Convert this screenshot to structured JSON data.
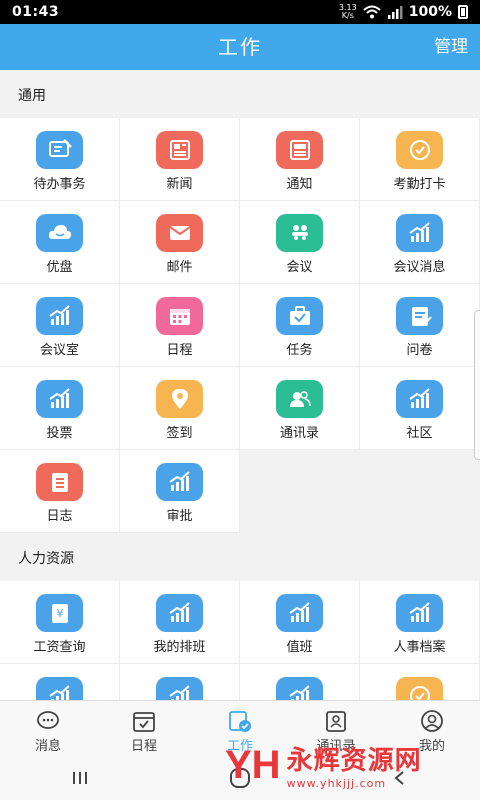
{
  "status_bar": {
    "time": "01:43",
    "net_speed_value": "3.13",
    "net_speed_unit": "K/s",
    "battery": "100%"
  },
  "header": {
    "title": "工作",
    "manage": "管理"
  },
  "sections": [
    {
      "title": "通用",
      "items": [
        {
          "label": "待办事务",
          "icon": "todo-icon",
          "color": "#4aa3e9"
        },
        {
          "label": "新闻",
          "icon": "newspaper-icon",
          "color": "#f06a5c"
        },
        {
          "label": "通知",
          "icon": "notice-icon",
          "color": "#f06a5c"
        },
        {
          "label": "考勤打卡",
          "icon": "attendance-icon",
          "color": "#f7b552"
        },
        {
          "label": "优盘",
          "icon": "cloud-icon",
          "color": "#4aa3e9"
        },
        {
          "label": "邮件",
          "icon": "mail-icon",
          "color": "#f06a5c"
        },
        {
          "label": "会议",
          "icon": "meeting-icon",
          "color": "#2bbd93"
        },
        {
          "label": "会议消息",
          "icon": "chart-icon",
          "color": "#4aa3e9"
        },
        {
          "label": "会议室",
          "icon": "chart-icon",
          "color": "#4aa3e9"
        },
        {
          "label": "日程",
          "icon": "calendar-icon",
          "color": "#f0699a"
        },
        {
          "label": "任务",
          "icon": "task-icon",
          "color": "#4aa3e9"
        },
        {
          "label": "问卷",
          "icon": "survey-icon",
          "color": "#4aa3e9"
        },
        {
          "label": "投票",
          "icon": "chart-icon",
          "color": "#4aa3e9"
        },
        {
          "label": "签到",
          "icon": "location-icon",
          "color": "#f7b552"
        },
        {
          "label": "通讯录",
          "icon": "contacts-icon",
          "color": "#2bbd93"
        },
        {
          "label": "社区",
          "icon": "chart-icon",
          "color": "#4aa3e9"
        },
        {
          "label": "日志",
          "icon": "log-icon",
          "color": "#f06a5c"
        },
        {
          "label": "审批",
          "icon": "chart-icon",
          "color": "#4aa3e9"
        }
      ]
    },
    {
      "title": "人力资源",
      "items": [
        {
          "label": "工资查询",
          "icon": "salary-icon",
          "color": "#4aa3e9"
        },
        {
          "label": "我的排班",
          "icon": "chart-icon",
          "color": "#4aa3e9"
        },
        {
          "label": "值班",
          "icon": "chart-icon",
          "color": "#4aa3e9"
        },
        {
          "label": "人事档案",
          "icon": "chart-icon",
          "color": "#4aa3e9"
        },
        {
          "label": "",
          "icon": "chart-icon",
          "color": "#4aa3e9"
        },
        {
          "label": "",
          "icon": "chart-icon",
          "color": "#4aa3e9"
        },
        {
          "label": "",
          "icon": "chart-icon",
          "color": "#4aa3e9"
        },
        {
          "label": "",
          "icon": "attendance-icon",
          "color": "#f7b552"
        }
      ]
    }
  ],
  "bottom_nav": [
    {
      "label": "消息",
      "icon": "message-icon",
      "active": false
    },
    {
      "label": "日程",
      "icon": "calendar-icon",
      "active": false
    },
    {
      "label": "工作",
      "icon": "work-icon",
      "active": true
    },
    {
      "label": "通讯录",
      "icon": "contacts-icon",
      "active": false
    },
    {
      "label": "我的",
      "icon": "profile-icon",
      "active": false
    }
  ],
  "watermark": {
    "logo": "YH",
    "name": "永辉资源网",
    "url": "www.yhkjjj.com"
  }
}
